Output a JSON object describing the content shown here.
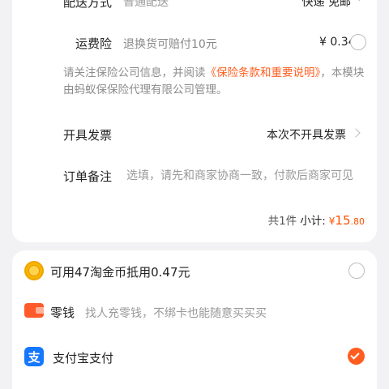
{
  "order_card": {
    "delivery_row": {
      "label": "配送方式",
      "method": "普通配送",
      "value": "快递 免邮"
    },
    "insurance": {
      "label": "运费险",
      "description": "退换货可赔付10元",
      "price": "¥ 0.34",
      "selected": false
    },
    "notice": {
      "text_before": "请关注保险公司信息，并阅读",
      "link_text": "《保险条款和重要说明》",
      "text_after": "，本模块由蚂蚁保保险代理有限公司管理。"
    },
    "invoice": {
      "label": "开具发票",
      "value": "本次不开具发票"
    },
    "order_note": {
      "label": "订单备注",
      "placeholder": "选填，请先和商家协商一致，付款后商家可见"
    },
    "summary": {
      "count": "共1件",
      "subtotal_label": "小计:",
      "currency": "¥",
      "amount_integer": "15",
      "amount_decimal": ".80"
    }
  },
  "payment_card": {
    "coins": {
      "label": "可用47淘金币抵用0.47元",
      "selected": false,
      "icon": "coin-icon"
    },
    "wallet": {
      "label": "零钱",
      "description": "找人充零钱，不绑卡也能随意买买买",
      "icon": "wallet-icon"
    },
    "alipay": {
      "label": "支付宝支付",
      "icon_glyph": "支",
      "selected": true
    }
  },
  "colors": {
    "accent": "#ff5000",
    "link": "#ff5d1f",
    "alipay": "#1677ff",
    "coin": "#f7b500",
    "wallet": "#ff5a2a"
  }
}
